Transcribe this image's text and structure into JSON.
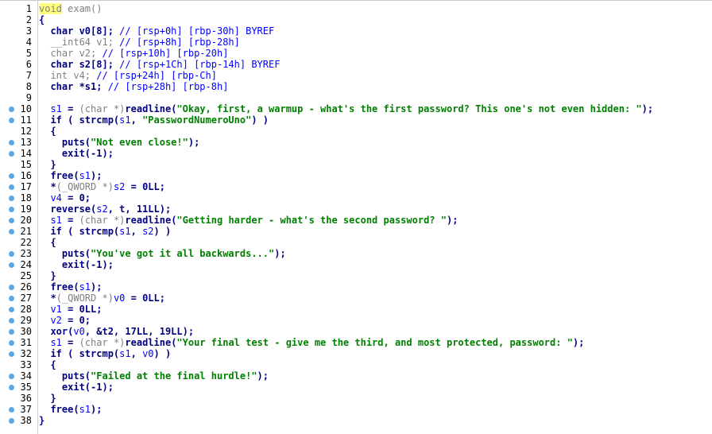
{
  "editor": {
    "lines": [
      {
        "n": "1",
        "bp": false,
        "tokens": [
          {
            "t": "void",
            "c": "hl"
          },
          {
            "t": " exam()",
            "c": "g"
          }
        ]
      },
      {
        "n": "2",
        "bp": false,
        "tokens": [
          {
            "t": "{",
            "c": "k"
          }
        ]
      },
      {
        "n": "3",
        "bp": false,
        "tokens": [
          {
            "t": "  char v0[8]; ",
            "c": "k"
          },
          {
            "t": "// [rsp+0h] [rbp-30h] BYREF",
            "c": "cm"
          }
        ]
      },
      {
        "n": "4",
        "bp": false,
        "tokens": [
          {
            "t": "  __int64 v1; ",
            "c": "g"
          },
          {
            "t": "// [rsp+8h] [rbp-28h]",
            "c": "cm"
          }
        ]
      },
      {
        "n": "5",
        "bp": false,
        "tokens": [
          {
            "t": "  char v2; ",
            "c": "g"
          },
          {
            "t": "// [rsp+10h] [rbp-20h]",
            "c": "cm"
          }
        ]
      },
      {
        "n": "6",
        "bp": false,
        "tokens": [
          {
            "t": "  char s2[8]; ",
            "c": "k"
          },
          {
            "t": "// [rsp+1Ch] [rbp-14h] BYREF",
            "c": "cm"
          }
        ]
      },
      {
        "n": "7",
        "bp": false,
        "tokens": [
          {
            "t": "  int v4; ",
            "c": "g"
          },
          {
            "t": "// [rsp+24h] [rbp-Ch]",
            "c": "cm"
          }
        ]
      },
      {
        "n": "8",
        "bp": false,
        "tokens": [
          {
            "t": "  char *s1; ",
            "c": "k"
          },
          {
            "t": "// [rsp+28h] [rbp-8h]",
            "c": "cm"
          }
        ]
      },
      {
        "n": "9",
        "bp": false,
        "tokens": []
      },
      {
        "n": "10",
        "bp": true,
        "tokens": [
          {
            "t": "  ",
            "c": "k"
          },
          {
            "t": "s1",
            "c": "v"
          },
          {
            "t": " = ",
            "c": "k"
          },
          {
            "t": "(char *)",
            "c": "g"
          },
          {
            "t": "readline(",
            "c": "k"
          },
          {
            "t": "\"Okay, first, a warmup - what's the first password? This one's not even hidden: \"",
            "c": "s"
          },
          {
            "t": ");",
            "c": "k"
          }
        ]
      },
      {
        "n": "11",
        "bp": true,
        "tokens": [
          {
            "t": "  if ( strcmp(",
            "c": "k"
          },
          {
            "t": "s1",
            "c": "v"
          },
          {
            "t": ", ",
            "c": "k"
          },
          {
            "t": "\"PasswordNumeroUno\"",
            "c": "s"
          },
          {
            "t": ") )",
            "c": "k"
          }
        ]
      },
      {
        "n": "12",
        "bp": false,
        "tokens": [
          {
            "t": "  {",
            "c": "k"
          }
        ]
      },
      {
        "n": "13",
        "bp": true,
        "tokens": [
          {
            "t": "    puts(",
            "c": "k"
          },
          {
            "t": "\"Not even close!\"",
            "c": "s"
          },
          {
            "t": ");",
            "c": "k"
          }
        ]
      },
      {
        "n": "14",
        "bp": true,
        "tokens": [
          {
            "t": "    exit(-1);",
            "c": "k"
          }
        ]
      },
      {
        "n": "15",
        "bp": false,
        "tokens": [
          {
            "t": "  }",
            "c": "k"
          }
        ]
      },
      {
        "n": "16",
        "bp": true,
        "tokens": [
          {
            "t": "  free(",
            "c": "k"
          },
          {
            "t": "s1",
            "c": "v"
          },
          {
            "t": ");",
            "c": "k"
          }
        ]
      },
      {
        "n": "17",
        "bp": true,
        "tokens": [
          {
            "t": "  *",
            "c": "k"
          },
          {
            "t": "(_QWORD *)",
            "c": "g"
          },
          {
            "t": "s2",
            "c": "v"
          },
          {
            "t": " = 0LL;",
            "c": "k"
          }
        ]
      },
      {
        "n": "18",
        "bp": true,
        "tokens": [
          {
            "t": "  ",
            "c": "k"
          },
          {
            "t": "v4",
            "c": "v"
          },
          {
            "t": " = 0;",
            "c": "k"
          }
        ]
      },
      {
        "n": "19",
        "bp": true,
        "tokens": [
          {
            "t": "  reverse(",
            "c": "k"
          },
          {
            "t": "s2",
            "c": "v"
          },
          {
            "t": ", t, 11LL);",
            "c": "k"
          }
        ]
      },
      {
        "n": "20",
        "bp": true,
        "tokens": [
          {
            "t": "  ",
            "c": "k"
          },
          {
            "t": "s1",
            "c": "v"
          },
          {
            "t": " = ",
            "c": "k"
          },
          {
            "t": "(char *)",
            "c": "g"
          },
          {
            "t": "readline(",
            "c": "k"
          },
          {
            "t": "\"Getting harder - what's the second password? \"",
            "c": "s"
          },
          {
            "t": ");",
            "c": "k"
          }
        ]
      },
      {
        "n": "21",
        "bp": true,
        "tokens": [
          {
            "t": "  if ( strcmp(",
            "c": "k"
          },
          {
            "t": "s1",
            "c": "v"
          },
          {
            "t": ", ",
            "c": "k"
          },
          {
            "t": "s2",
            "c": "v"
          },
          {
            "t": ") )",
            "c": "k"
          }
        ]
      },
      {
        "n": "22",
        "bp": false,
        "tokens": [
          {
            "t": "  {",
            "c": "k"
          }
        ]
      },
      {
        "n": "23",
        "bp": true,
        "tokens": [
          {
            "t": "    puts(",
            "c": "k"
          },
          {
            "t": "\"You've got it all backwards...\"",
            "c": "s"
          },
          {
            "t": ");",
            "c": "k"
          }
        ]
      },
      {
        "n": "24",
        "bp": true,
        "tokens": [
          {
            "t": "    exit(-1);",
            "c": "k"
          }
        ]
      },
      {
        "n": "25",
        "bp": false,
        "tokens": [
          {
            "t": "  }",
            "c": "k"
          }
        ]
      },
      {
        "n": "26",
        "bp": true,
        "tokens": [
          {
            "t": "  free(",
            "c": "k"
          },
          {
            "t": "s1",
            "c": "v"
          },
          {
            "t": ");",
            "c": "k"
          }
        ]
      },
      {
        "n": "27",
        "bp": true,
        "tokens": [
          {
            "t": "  *",
            "c": "k"
          },
          {
            "t": "(_QWORD *)",
            "c": "g"
          },
          {
            "t": "v0",
            "c": "v"
          },
          {
            "t": " = 0LL;",
            "c": "k"
          }
        ]
      },
      {
        "n": "28",
        "bp": true,
        "tokens": [
          {
            "t": "  ",
            "c": "k"
          },
          {
            "t": "v1",
            "c": "v"
          },
          {
            "t": " = 0LL;",
            "c": "k"
          }
        ]
      },
      {
        "n": "29",
        "bp": true,
        "tokens": [
          {
            "t": "  ",
            "c": "k"
          },
          {
            "t": "v2",
            "c": "v"
          },
          {
            "t": " = 0;",
            "c": "k"
          }
        ]
      },
      {
        "n": "30",
        "bp": true,
        "tokens": [
          {
            "t": "  xor(",
            "c": "k"
          },
          {
            "t": "v0",
            "c": "v"
          },
          {
            "t": ", &t2, 17LL, 19LL);",
            "c": "k"
          }
        ]
      },
      {
        "n": "31",
        "bp": true,
        "tokens": [
          {
            "t": "  ",
            "c": "k"
          },
          {
            "t": "s1",
            "c": "v"
          },
          {
            "t": " = ",
            "c": "k"
          },
          {
            "t": "(char *)",
            "c": "g"
          },
          {
            "t": "readline(",
            "c": "k"
          },
          {
            "t": "\"Your final test - give me the third, and most protected, password: \"",
            "c": "s"
          },
          {
            "t": ");",
            "c": "k"
          }
        ]
      },
      {
        "n": "32",
        "bp": true,
        "tokens": [
          {
            "t": "  if ( strcmp(",
            "c": "k"
          },
          {
            "t": "s1",
            "c": "v"
          },
          {
            "t": ", ",
            "c": "k"
          },
          {
            "t": "v0",
            "c": "v"
          },
          {
            "t": ") )",
            "c": "k"
          }
        ]
      },
      {
        "n": "33",
        "bp": false,
        "tokens": [
          {
            "t": "  {",
            "c": "k"
          }
        ]
      },
      {
        "n": "34",
        "bp": true,
        "tokens": [
          {
            "t": "    puts(",
            "c": "k"
          },
          {
            "t": "\"Failed at the final hurdle!\"",
            "c": "s"
          },
          {
            "t": ");",
            "c": "k"
          }
        ]
      },
      {
        "n": "35",
        "bp": true,
        "tokens": [
          {
            "t": "    exit(-1);",
            "c": "k"
          }
        ]
      },
      {
        "n": "36",
        "bp": false,
        "tokens": [
          {
            "t": "  }",
            "c": "k"
          }
        ]
      },
      {
        "n": "37",
        "bp": true,
        "tokens": [
          {
            "t": "  free(",
            "c": "k"
          },
          {
            "t": "s1",
            "c": "v"
          },
          {
            "t": ");",
            "c": "k"
          }
        ]
      },
      {
        "n": "38",
        "bp": true,
        "tokens": [
          {
            "t": "}",
            "c": "k"
          }
        ]
      }
    ],
    "colors": {
      "keyword": "#000080",
      "string": "#008000",
      "comment": "#0000ff",
      "variable": "#0000ff",
      "gray": "#808080",
      "highlight": "#ffff80",
      "breakpoint_dot": "#5aa7e6"
    }
  }
}
